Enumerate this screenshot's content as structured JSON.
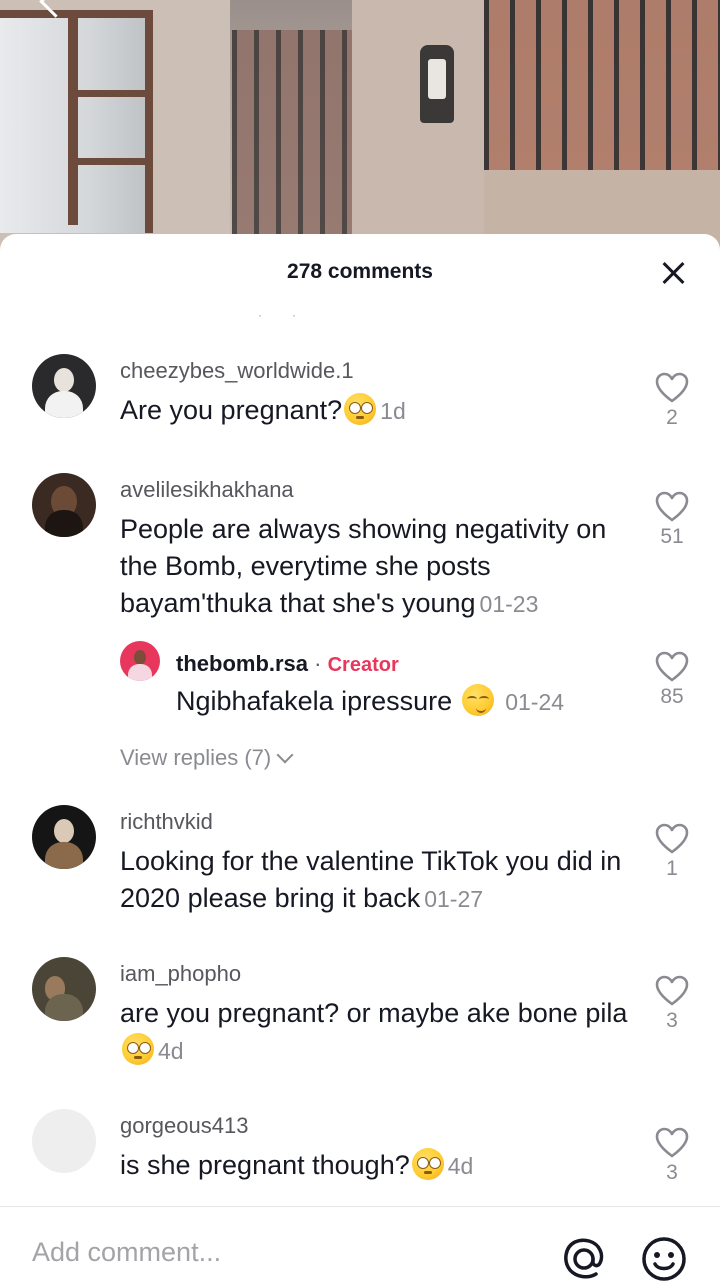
{
  "sheet": {
    "title": "278 comments"
  },
  "comments": [
    {
      "username": "cheezybes_worldwide.1",
      "text": "Are you pregnant?",
      "emoji": "flushed-face",
      "time": "1d",
      "likes": "2"
    },
    {
      "username": "avelilesikhakhana",
      "text": "People are always showing negativity on the Bomb, everytime she posts bayam'thuka that she's young",
      "time": "01-23",
      "likes": "51",
      "reply": {
        "username": "thebomb.rsa",
        "separator": "·",
        "badge": "Creator",
        "text": "Ngibhafakela ipressure",
        "emoji": "smirking-face",
        "time": "01-24",
        "likes": "85"
      },
      "view_replies": "View replies (7)"
    },
    {
      "username": "richthvkid",
      "text": "Looking for the valentine TikTok you did in 2020 please bring it back",
      "time": "01-27",
      "likes": "1"
    },
    {
      "username": "iam_phopho",
      "text": "are you pregnant? or maybe ake bone pila",
      "emoji": "flushed-face",
      "time": "4d",
      "likes": "3"
    },
    {
      "username": "gorgeous413",
      "text": "is she pregnant though?",
      "emoji": "flushed-face",
      "time": "4d",
      "likes": "3"
    }
  ],
  "add_comment": {
    "placeholder": "Add comment..."
  },
  "colors": {
    "creator_badge": "#e8375c",
    "text_primary": "#161823",
    "text_secondary": "#8a8b91"
  }
}
